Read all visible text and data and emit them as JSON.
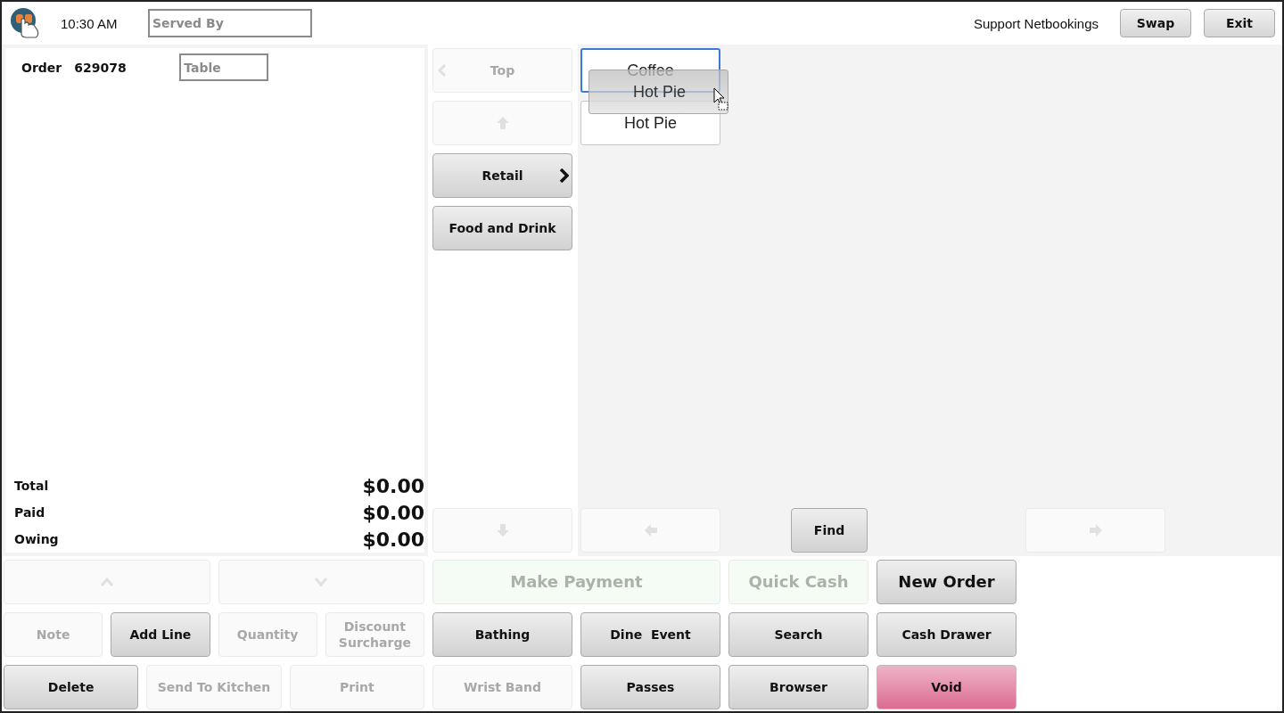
{
  "header": {
    "time": "10:30 AM",
    "served_by": {
      "placeholder": "Served By"
    },
    "user": "Support Netbookings",
    "buttons": [
      {
        "label": "Swap"
      },
      {
        "label": "Exit"
      }
    ]
  },
  "order": {
    "label": "Order",
    "number": "629078",
    "table": {
      "placeholder": "Table"
    },
    "totals": [
      {
        "label": "Total",
        "amount": "$0.00"
      },
      {
        "label": "Paid",
        "amount": "$0.00"
      },
      {
        "label": "Owing",
        "amount": "$0.00"
      }
    ]
  },
  "categories": {
    "top": {
      "label": "Top",
      "disabled": true
    },
    "up": {
      "disabled": true
    },
    "items": [
      {
        "label": "Retail",
        "has_children": true
      },
      {
        "label": "Food and Drink",
        "has_children": false
      }
    ],
    "down": {
      "disabled": true
    }
  },
  "products": {
    "items": [
      {
        "label": "Coffee",
        "selected": true
      },
      {
        "label": "Hot Pie",
        "selected": false
      }
    ],
    "dragging": {
      "label": "Hot Pie"
    },
    "prev": {
      "disabled": true
    },
    "find": {
      "label": "Find",
      "disabled": false
    },
    "next": {
      "disabled": true
    }
  },
  "order_buttons": [
    [
      {
        "kind": "arrow-up",
        "disabled": true
      },
      {
        "kind": "arrow-down",
        "disabled": true
      }
    ],
    [
      {
        "kind": "text",
        "label": "Note",
        "disabled": true
      },
      {
        "kind": "text",
        "label": "Add Line",
        "disabled": false
      },
      {
        "kind": "text",
        "label": "Quantity",
        "disabled": true
      },
      {
        "kind": "text",
        "label": "Discount Surcharge",
        "disabled": true
      }
    ],
    [
      {
        "kind": "text",
        "label": "Delete",
        "disabled": false
      },
      {
        "kind": "text",
        "label": "Send To Kitchen",
        "disabled": true
      },
      {
        "kind": "text",
        "label": "Print",
        "disabled": true
      }
    ]
  ],
  "action_buttons": [
    {
      "kind": "payment",
      "label": "Make Payment",
      "disabled": true,
      "wide": true
    },
    {
      "kind": "payment",
      "label": "Quick Cash",
      "disabled": true,
      "wide": false
    },
    {
      "kind": "large",
      "label": "New Order",
      "disabled": false,
      "wide": false
    },
    {
      "kind": "normal",
      "label": "Bathing",
      "disabled": false,
      "wide": false
    },
    {
      "kind": "normal",
      "label": "Dine  Event",
      "disabled": false,
      "wide": false
    },
    {
      "kind": "normal",
      "label": "Search",
      "disabled": false,
      "wide": false
    },
    {
      "kind": "normal",
      "label": "Cash Drawer",
      "disabled": false,
      "wide": false
    },
    {
      "kind": "normal",
      "label": "Wrist Band",
      "disabled": true,
      "wide": false
    },
    {
      "kind": "normal",
      "label": "Passes",
      "disabled": false,
      "wide": false
    },
    {
      "kind": "normal",
      "label": "Browser",
      "disabled": false,
      "wide": false
    },
    {
      "kind": "danger",
      "label": "Void",
      "disabled": false,
      "wide": false
    }
  ]
}
